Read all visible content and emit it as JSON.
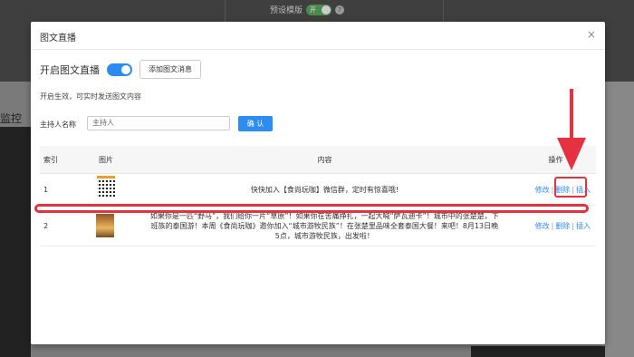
{
  "background": {
    "preview_label": "预设模版",
    "preview_toggle": "开",
    "help_icon": "?",
    "left_label": "监控"
  },
  "modal": {
    "title": "图文直播",
    "close": "×",
    "enable_label": "开启图文直播",
    "add_button": "添加图文消息",
    "hint": "开启生效，可实时发送图文内容",
    "host_label": "主持人名称",
    "host_placeholder": "主持人",
    "confirm_button": "确 认"
  },
  "table": {
    "headers": [
      "索引",
      "图片",
      "内容",
      "操作"
    ],
    "rows": [
      {
        "index": "1",
        "image": "qr-code-image",
        "content": "快快加入【食尚玩咖】微信群，定时有惊喜哦!"
      },
      {
        "index": "2",
        "image": "poster-image",
        "content": "如果你是一匹“野马”，我们给你一片“草原”！如果你在苦痛挣扎，一起大喊“萨瓦迪卡”！城市中的张楚楚，下班族的泰国游！本周《食尚玩咖》邀你加入“城市游牧民族”！在张楚里品味全套泰国大餐！来吧！8月13日晚5点，城市游牧民族，出发啦！"
      }
    ],
    "actions": {
      "edit": "修改",
      "delete": "删除",
      "insert": "插入",
      "separator": "|"
    }
  },
  "colors": {
    "accent": "#2d8cf0",
    "annotation_red": "#e53240"
  }
}
